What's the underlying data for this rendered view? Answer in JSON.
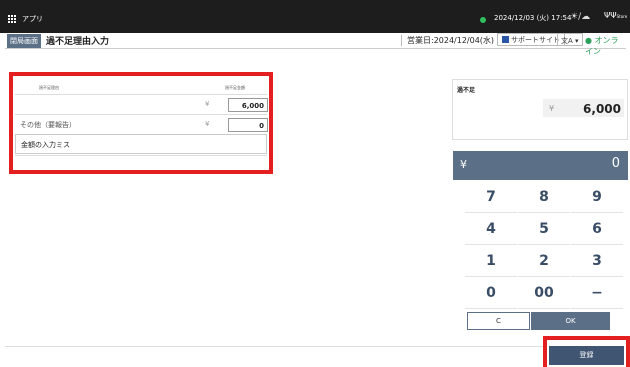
{
  "topbar": {
    "apps_label": "アプリ",
    "datetime": "2024/12/03 (火) 17:54",
    "weather": "☀/☁",
    "store_label": "Store"
  },
  "header": {
    "back_label": "閉局画面",
    "title": "過不足理由入力",
    "business_date": "営業日:2024/12/04(水)",
    "support_label": "サポートサイト",
    "language_label": "文A ▾",
    "status_label": "● オンライン"
  },
  "reasons": {
    "col_reason": "過不足理由",
    "col_amount": "過不足金額",
    "rows": [
      {
        "label": "",
        "yen": "¥",
        "amount": "6,000"
      },
      {
        "label": "その他（要報告）",
        "yen": "¥",
        "amount": "0"
      }
    ],
    "note": "金額の入力ミス"
  },
  "total": {
    "label": "過不足",
    "yen": "¥",
    "value": "6,000"
  },
  "keypad": {
    "display_yen": "¥",
    "display_value": "0",
    "keys": [
      "7",
      "8",
      "9",
      "4",
      "5",
      "6",
      "1",
      "2",
      "3",
      "0",
      "00",
      "−"
    ],
    "clear_label": "C",
    "ok_label": "OK"
  },
  "register_label": "登録",
  "colors": {
    "accent": "#5b6f87",
    "highlight": "#e41f1f",
    "online": "#2aa05a"
  }
}
